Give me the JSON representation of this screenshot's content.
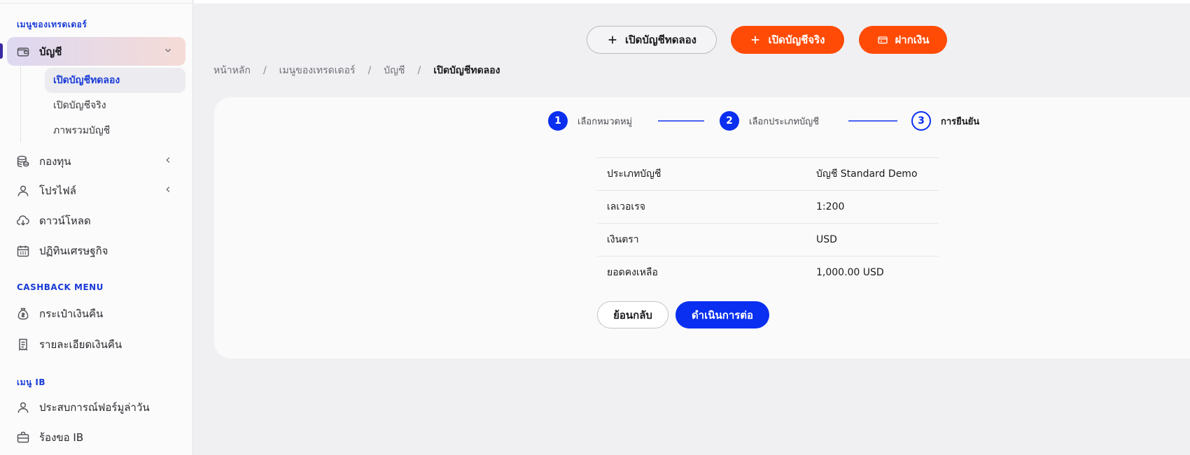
{
  "sidebar": {
    "section_trader": "เมนูของเทรดเดอร์",
    "account": {
      "label": "บัญชี",
      "icon": "wallet-icon"
    },
    "account_sub": [
      {
        "label": "เปิดบัญชีทดลอง"
      },
      {
        "label": "เปิดบัญชีจริง"
      },
      {
        "label": "ภาพรวมบัญชี"
      }
    ],
    "funds": {
      "label": "กองทุน",
      "icon": "coins-icon"
    },
    "profile": {
      "label": "โปรไฟล์",
      "icon": "user-icon"
    },
    "download": {
      "label": "ดาวน์โหลด",
      "icon": "cloud-download-icon"
    },
    "calendar": {
      "label": "ปฏิทินเศรษฐกิจ",
      "icon": "calendar-icon"
    },
    "section_cashback": "CASHBACK MENU",
    "cashback_wallet": {
      "label": "กระเป๋าเงินคืน",
      "icon": "money-bag-icon"
    },
    "cashback_details": {
      "label": "รายละเอียดเงินคืน",
      "icon": "receipt-icon"
    },
    "section_ib": "เมนู IB",
    "ib_experience": {
      "label": "ประสบการณ์ฟอร์มูล่าวัน",
      "icon": "user-icon"
    },
    "ib_request": {
      "label": "ร้องขอ IB",
      "icon": "briefcase-icon"
    }
  },
  "topbar": {
    "demo_button": "เปิดบัญชีทดลอง",
    "real_button": "เปิดบัญชีจริง",
    "deposit_button": "ฝากเงิน"
  },
  "breadcrumb": {
    "items": [
      "หน้าหลัก",
      "เมนูของเทรดเดอร์",
      "บัญชี"
    ],
    "current": "เปิดบัญชีทดลอง"
  },
  "steps": [
    {
      "number": "1",
      "label": "เลือกหมวดหมู่"
    },
    {
      "number": "2",
      "label": "เลือกประเภทบัญชี"
    },
    {
      "number": "3",
      "label": "การยืนยัน"
    }
  ],
  "summary": {
    "rows": [
      {
        "key": "ประเภทบัญชี",
        "value": "บัญชี Standard Demo"
      },
      {
        "key": "เลเวอเรจ",
        "value": "1:200"
      },
      {
        "key": "เงินตรา",
        "value": "USD"
      },
      {
        "key": "ยอดคงเหลือ",
        "value": "1,000.00 USD"
      }
    ]
  },
  "actions": {
    "back": "ย้อนกลับ",
    "next": "ดำเนินการต่อ"
  },
  "colors": {
    "primary_blue": "#0a2ff0",
    "accent_orange": "#ff4b06"
  }
}
